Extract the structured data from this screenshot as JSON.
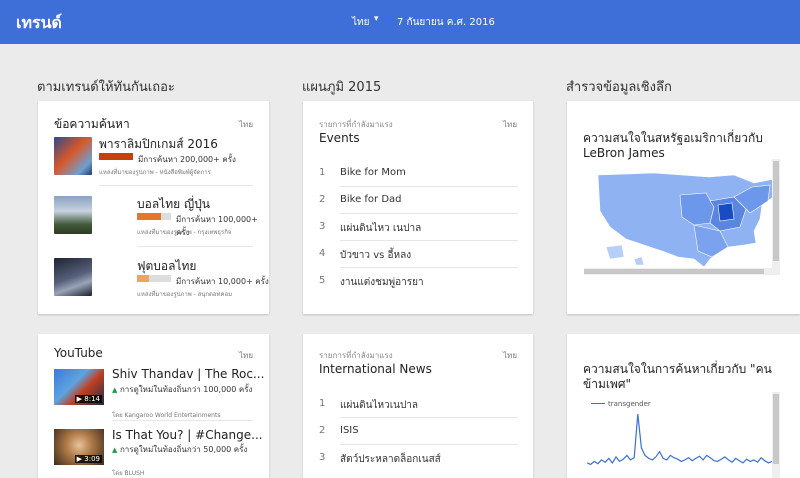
{
  "header": {
    "brand": "เทรนด์",
    "region": "ไทย",
    "date": "7 กันยายน ค.ศ. 2016"
  },
  "columns": {
    "left_title": "ตามเทรนด์ให้ทันกันเถอะ",
    "middle_title": "แผนภูมิ 2015",
    "right_title": "สำรวจข้อมูลเชิงลึก"
  },
  "search_stories": {
    "title": "ข้อความค้นหา",
    "region": "ไทย",
    "items": [
      {
        "title": "พาราลิมปิกเกมส์ 2016",
        "searches": "มีการค้นหา 200,000+ ครั้ง",
        "source": "แหล่งที่มาของรูปภาพ - หนังสือพิมพ์ผู้จัดการ",
        "fill": 1.0,
        "bar_color": "#c8410b"
      },
      {
        "title": "บอลไทย ญี่ปุ่น",
        "searches": "มีการค้นหา 100,000+ ครั้ง",
        "source": "แหล่งที่มาของรูปภาพ - กรุงเทพธุรกิจ",
        "fill": 0.72,
        "bar_color": "#e3782a"
      },
      {
        "title": "ฟุตบอลไทย",
        "searches": "มีการค้นหา 10,000+ ครั้ง",
        "source": "แหล่งที่มาของรูปภาพ - สนุกดอทคอม",
        "fill": 0.35,
        "bar_color": "#f2a25b"
      }
    ]
  },
  "events_card": {
    "sub": "รายการที่กำลังมาแรง",
    "title": "Events",
    "region": "ไทย",
    "items": [
      {
        "rank": "1",
        "label": "Bike for Mom"
      },
      {
        "rank": "2",
        "label": "Bike for Dad"
      },
      {
        "rank": "3",
        "label": "แผ่นดินไหว เนปาล"
      },
      {
        "rank": "4",
        "label": "บัวขาว vs อี้หลง"
      },
      {
        "rank": "5",
        "label": "งานแต่งชมพู่อารยา"
      }
    ]
  },
  "map_card": {
    "title": "ความสนใจในสหรัฐอเมริกาเกี่ยวกับ LeBron James"
  },
  "youtube": {
    "title": "YouTube",
    "region": "ไทย",
    "items": [
      {
        "title": "Shiv Thandav | The Roc...",
        "duration": "8:14",
        "stat": "การดูใหม่ในท้องถิ่นกว่า 100,000 ครั้ง",
        "by": "โดย Kangaroo World Entertainments"
      },
      {
        "title": "Is That You? | #Change...",
        "duration": "3:09",
        "stat": "การดูใหม่ในท้องถิ่นกว่า 50,000 ครั้ง",
        "by": "โดย BLUSH"
      }
    ]
  },
  "news_card": {
    "sub": "รายการที่กำลังมาแรง",
    "title": "International News",
    "region": "ไทย",
    "items": [
      {
        "rank": "1",
        "label": "แผ่นดินไหวเนปาล"
      },
      {
        "rank": "2",
        "label": "ISIS"
      },
      {
        "rank": "3",
        "label": "สัตว์ประหลาดล็อกเนสส์"
      }
    ]
  },
  "interest_card": {
    "title": "ความสนใจในการค้นหาเกี่ยวกับ \"คนข้ามเพศ\"",
    "legend": "transgender",
    "line_color": "#3a6fd8",
    "series": [
      20,
      18,
      22,
      19,
      24,
      21,
      26,
      20,
      28,
      22,
      25,
      30,
      24,
      27,
      85,
      40,
      30,
      26,
      24,
      28,
      35,
      26,
      24,
      30,
      27,
      25,
      22,
      24,
      27,
      23,
      26,
      29,
      24,
      30,
      27,
      23,
      22,
      25,
      28,
      24,
      21,
      26,
      23,
      20,
      25,
      22,
      24,
      21,
      27,
      23,
      20,
      22
    ]
  }
}
